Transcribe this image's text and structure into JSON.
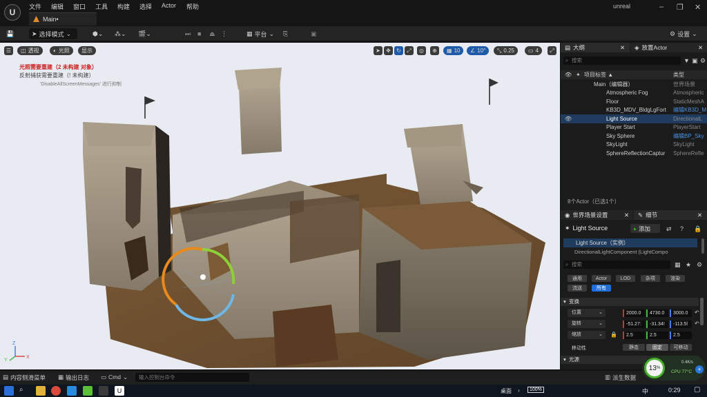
{
  "app": {
    "menus": [
      "文件",
      "编辑",
      "窗口",
      "工具",
      "构建",
      "选择",
      "Actor",
      "帮助"
    ],
    "tab": "Main•",
    "window_title": "unreal"
  },
  "toolbar": {
    "mode": "选择模式",
    "platform": "平台",
    "settings": "设置"
  },
  "viewport": {
    "btn_perspective": "透视",
    "btn_lit": "光照",
    "btn_show": "显示",
    "grid": "10",
    "angle": "10°",
    "scale": "0.25",
    "camera": "4",
    "warn1": "光照需要重建（2 未构建 对象）",
    "warn2": "反射捕获需要重建（! 未构建）",
    "warn3": "'DisableAllScreenMessages' 进行抑制"
  },
  "outliner": {
    "title": "大纲",
    "title2": "放置Actor",
    "search": "搜索",
    "col_label": "项目标签 ▲",
    "col_type": "类型",
    "items": [
      {
        "name": "Main（编辑器）",
        "type": "世界场景"
      },
      {
        "name": "Atmospheric Fog",
        "type": "Atmospheric"
      },
      {
        "name": "Floor",
        "type": "StaticMeshA"
      },
      {
        "name": "KB3D_MDV_BldgLgFort",
        "type": "编辑KB3D_M"
      },
      {
        "name": "Light Source",
        "type": "DirectionalL"
      },
      {
        "name": "Player Start",
        "type": "PlayerStart"
      },
      {
        "name": "Sky Sphere",
        "type": "编辑BP_Sky"
      },
      {
        "name": "SkyLight",
        "type": "SkyLight"
      },
      {
        "name": "SphereReflectionCaptur",
        "type": "SphereRefle"
      }
    ],
    "footer": "8个Actor（已选1个）"
  },
  "details": {
    "tab1": "世界场景设置",
    "tab2": "细节",
    "actor": "Light Source",
    "add": "添加",
    "instance": "Light Source（实例）",
    "component": "DirectionalLightComponent (LightCompo",
    "search": "搜索",
    "filters": [
      "通用",
      "Actor",
      "LOD",
      "杂项",
      "渲染",
      "流送",
      "所有"
    ],
    "section_transform": "变换",
    "location_label": "位置",
    "location": [
      "2000.0",
      "4730.0",
      "3000.0"
    ],
    "rotation_label": "旋转",
    "rotation": [
      "-51.27:",
      "-31.34!",
      "-113.5l"
    ],
    "scale_label": "缩放",
    "scale": [
      "2.5",
      "2.5",
      "2.5"
    ],
    "mobility_label": "移动性",
    "mobility": [
      "静态",
      "固定",
      "可移动"
    ],
    "section_light": "光源"
  },
  "status": {
    "content": "内容侧滑菜单",
    "output": "输出日志",
    "cmd": "Cmd",
    "cmd_placeholder": "输入控制台命令",
    "derived": "派生数据",
    "cpu_pct": "13",
    "cpu_temp": "CPU 77°C",
    "net": "0.4K/s"
  },
  "taskbar": {
    "desktop": "桌面",
    "battery": "100%",
    "lang": "中",
    "time": "0:29"
  },
  "colors": {
    "accent": "#1f6fd8",
    "play": "#4cbb2e",
    "warning": "#cc2222"
  }
}
